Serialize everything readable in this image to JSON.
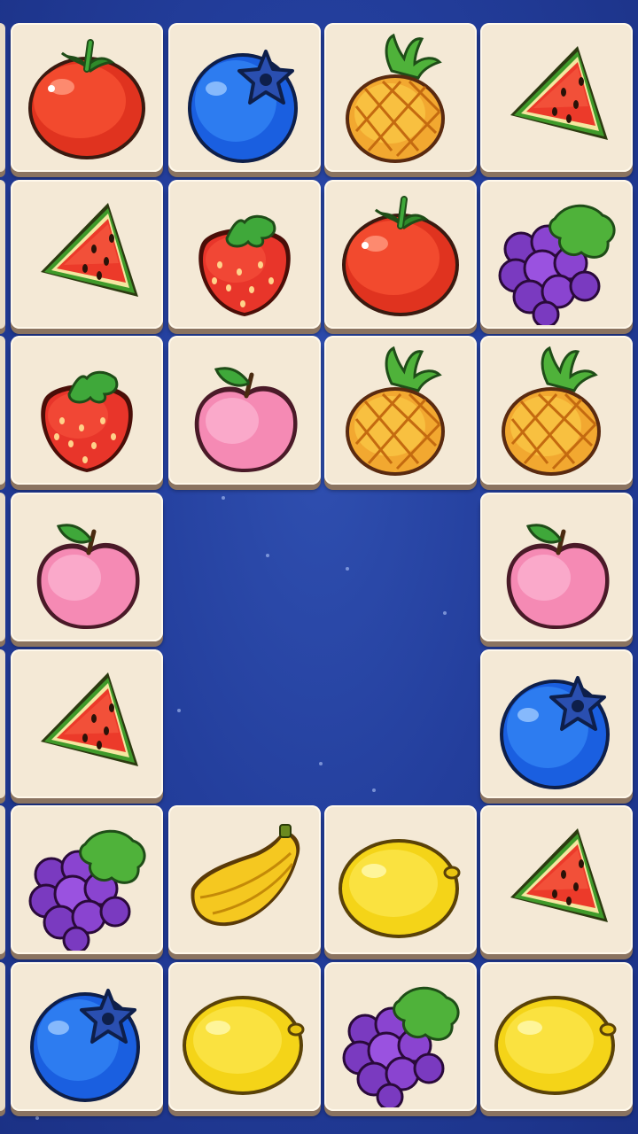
{
  "board": {
    "columns": 4,
    "rows": 7,
    "tiles": [
      {
        "row": 0,
        "col": 0,
        "fruit": "tomato"
      },
      {
        "row": 0,
        "col": 1,
        "fruit": "blueberry"
      },
      {
        "row": 0,
        "col": 2,
        "fruit": "pineapple"
      },
      {
        "row": 0,
        "col": 3,
        "fruit": "watermelon"
      },
      {
        "row": 1,
        "col": 0,
        "fruit": "watermelon"
      },
      {
        "row": 1,
        "col": 1,
        "fruit": "strawberry"
      },
      {
        "row": 1,
        "col": 2,
        "fruit": "tomato"
      },
      {
        "row": 1,
        "col": 3,
        "fruit": "grapes"
      },
      {
        "row": 2,
        "col": 0,
        "fruit": "strawberry"
      },
      {
        "row": 2,
        "col": 1,
        "fruit": "peach"
      },
      {
        "row": 2,
        "col": 2,
        "fruit": "pineapple"
      },
      {
        "row": 2,
        "col": 3,
        "fruit": "pineapple"
      },
      {
        "row": 3,
        "col": 0,
        "fruit": "peach"
      },
      {
        "row": 3,
        "col": 3,
        "fruit": "peach"
      },
      {
        "row": 4,
        "col": 0,
        "fruit": "watermelon"
      },
      {
        "row": 4,
        "col": 3,
        "fruit": "blueberry"
      },
      {
        "row": 5,
        "col": 0,
        "fruit": "grapes"
      },
      {
        "row": 5,
        "col": 1,
        "fruit": "banana"
      },
      {
        "row": 5,
        "col": 2,
        "fruit": "lemon"
      },
      {
        "row": 5,
        "col": 3,
        "fruit": "watermelon"
      },
      {
        "row": 6,
        "col": 0,
        "fruit": "blueberry"
      },
      {
        "row": 6,
        "col": 1,
        "fruit": "lemon"
      },
      {
        "row": 6,
        "col": 2,
        "fruit": "grapes"
      },
      {
        "row": 6,
        "col": 3,
        "fruit": "lemon"
      }
    ]
  },
  "colors": {
    "background": "#233e9c",
    "tile_face": "#f4e9d6",
    "tile_shadow": "#8a7360"
  }
}
